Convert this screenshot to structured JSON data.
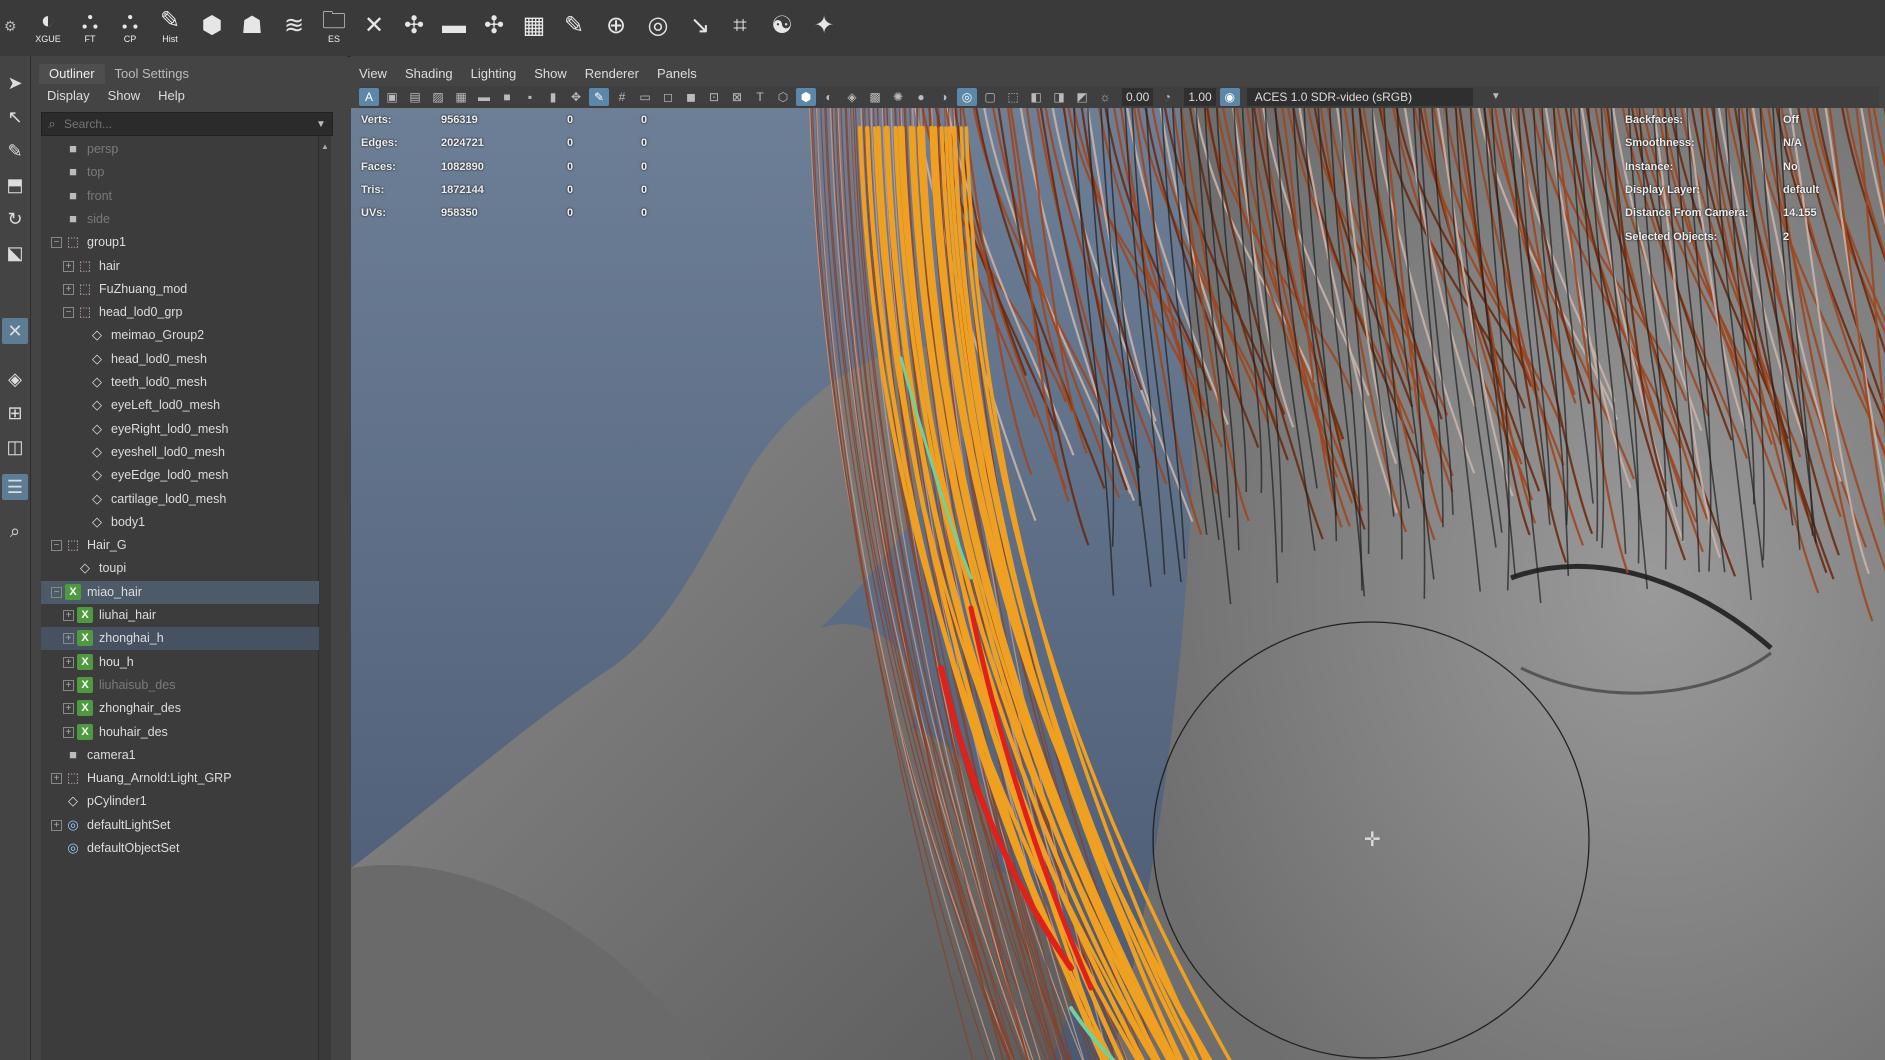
{
  "shelf": [
    {
      "icon": "xgen-logo-icon",
      "cap": "XGUE"
    },
    {
      "icon": "ft-icon",
      "cap": "FT"
    },
    {
      "icon": "cp-icon",
      "cap": "CP"
    },
    {
      "icon": "hist-icon",
      "cap": "Hist"
    },
    {
      "icon": "lattice-icon",
      "cap": ""
    },
    {
      "icon": "head-icon",
      "cap": ""
    },
    {
      "icon": "layers-icon",
      "cap": ""
    },
    {
      "icon": "folder-es-icon",
      "cap": "ES"
    },
    {
      "icon": "tool-icon",
      "cap": ""
    },
    {
      "icon": "transform-icon",
      "cap": ""
    },
    {
      "icon": "ruler-icon",
      "cap": ""
    },
    {
      "icon": "snap-icon",
      "cap": ""
    },
    {
      "icon": "grid-icon",
      "cap": ""
    },
    {
      "icon": "pen-icon",
      "cap": ""
    },
    {
      "icon": "sphere-grid-icon",
      "cap": ""
    },
    {
      "icon": "target-icon",
      "cap": ""
    },
    {
      "icon": "joint-icon",
      "cap": ""
    },
    {
      "icon": "bounds-icon",
      "cap": ""
    },
    {
      "icon": "yinyang-icon",
      "cap": ""
    },
    {
      "icon": "mask-icon",
      "cap": ""
    }
  ],
  "outliner": {
    "tabs": [
      "Outliner",
      "Tool Settings"
    ],
    "menu": [
      "Display",
      "Show",
      "Help"
    ],
    "search_placeholder": "Search...",
    "items": [
      {
        "label": "persp",
        "type": "cam",
        "depth": 1,
        "expand": "",
        "state": "dim"
      },
      {
        "label": "top",
        "type": "cam",
        "depth": 1,
        "expand": "",
        "state": "dim"
      },
      {
        "label": "front",
        "type": "cam",
        "depth": 1,
        "expand": "",
        "state": "dim"
      },
      {
        "label": "side",
        "type": "cam",
        "depth": 1,
        "expand": "",
        "state": "dim"
      },
      {
        "label": "group1",
        "type": "grp",
        "depth": 1,
        "expand": "−",
        "state": ""
      },
      {
        "label": "hair",
        "type": "grp",
        "depth": 2,
        "expand": "+",
        "state": ""
      },
      {
        "label": "FuZhuang_mod",
        "type": "grp",
        "depth": 2,
        "expand": "+",
        "state": ""
      },
      {
        "label": "head_lod0_grp",
        "type": "grp",
        "depth": 2,
        "expand": "−",
        "state": ""
      },
      {
        "label": "meimao_Group2",
        "type": "mesh",
        "depth": 3,
        "expand": "",
        "state": ""
      },
      {
        "label": "head_lod0_mesh",
        "type": "mesh",
        "depth": 3,
        "expand": "",
        "state": ""
      },
      {
        "label": "teeth_lod0_mesh",
        "type": "mesh",
        "depth": 3,
        "expand": "",
        "state": ""
      },
      {
        "label": "eyeLeft_lod0_mesh",
        "type": "mesh",
        "depth": 3,
        "expand": "",
        "state": ""
      },
      {
        "label": "eyeRight_lod0_mesh",
        "type": "mesh",
        "depth": 3,
        "expand": "",
        "state": ""
      },
      {
        "label": "eyeshell_lod0_mesh",
        "type": "mesh",
        "depth": 3,
        "expand": "",
        "state": ""
      },
      {
        "label": "eyeEdge_lod0_mesh",
        "type": "mesh",
        "depth": 3,
        "expand": "",
        "state": ""
      },
      {
        "label": "cartilage_lod0_mesh",
        "type": "mesh",
        "depth": 3,
        "expand": "",
        "state": ""
      },
      {
        "label": "body1",
        "type": "mesh",
        "depth": 3,
        "expand": "",
        "state": ""
      },
      {
        "label": "Hair_G",
        "type": "grp",
        "depth": 1,
        "expand": "−",
        "state": ""
      },
      {
        "label": "toupi",
        "type": "mesh",
        "depth": 2,
        "expand": "",
        "state": ""
      },
      {
        "label": "miao_hair",
        "type": "xg",
        "depth": 1,
        "expand": "−",
        "state": "sel"
      },
      {
        "label": "liuhai_hair",
        "type": "xg",
        "depth": 2,
        "expand": "+",
        "state": ""
      },
      {
        "label": "zhonghai_h",
        "type": "xg",
        "depth": 2,
        "expand": "+",
        "state": "sel2"
      },
      {
        "label": "hou_h",
        "type": "xg",
        "depth": 2,
        "expand": "+",
        "state": ""
      },
      {
        "label": "liuhaisub_des",
        "type": "xg",
        "depth": 2,
        "expand": "+",
        "state": "dim"
      },
      {
        "label": "zhonghair_des",
        "type": "xg",
        "depth": 2,
        "expand": "+",
        "state": ""
      },
      {
        "label": "houhair_des",
        "type": "xg",
        "depth": 2,
        "expand": "+",
        "state": ""
      },
      {
        "label": "camera1",
        "type": "cam",
        "depth": 1,
        "expand": "",
        "state": ""
      },
      {
        "label": "Huang_Arnold:Light_GRP",
        "type": "grp",
        "depth": 1,
        "expand": "+",
        "state": ""
      },
      {
        "label": "pCylinder1",
        "type": "mesh",
        "depth": 1,
        "expand": "",
        "state": ""
      },
      {
        "label": "defaultLightSet",
        "type": "set",
        "depth": 1,
        "expand": "+",
        "state": ""
      },
      {
        "label": "defaultObjectSet",
        "type": "set",
        "depth": 1,
        "expand": "",
        "state": ""
      }
    ]
  },
  "viewport": {
    "menu": [
      "View",
      "Shading",
      "Lighting",
      "Show",
      "Renderer",
      "Panels"
    ],
    "toolbar": {
      "near_value": "0.00",
      "far_value": "1.00",
      "color_space": "ACES 1.0 SDR-video (sRGB)"
    },
    "stats": [
      {
        "label": "Verts:",
        "v1": "956319",
        "v2": "0",
        "v3": "0"
      },
      {
        "label": "Edges:",
        "v1": "2024721",
        "v2": "0",
        "v3": "0"
      },
      {
        "label": "Faces:",
        "v1": "1082890",
        "v2": "0",
        "v3": "0"
      },
      {
        "label": "Tris:",
        "v1": "1872144",
        "v2": "0",
        "v3": "0"
      },
      {
        "label": "UVs:",
        "v1": "958350",
        "v2": "0",
        "v3": "0"
      }
    ],
    "info": [
      {
        "label": "Backfaces:",
        "value": "Off"
      },
      {
        "label": "Smoothness:",
        "value": "N/A"
      },
      {
        "label": "Instance:",
        "value": "No"
      },
      {
        "label": "Display Layer:",
        "value": "default"
      },
      {
        "label": "Distance From Camera:",
        "value": "14.155"
      },
      {
        "label": "Selected Objects:",
        "value": "2"
      }
    ]
  },
  "colors": {
    "selection": "#4d5a68",
    "hair_brown": "#9a4a22",
    "guide_orange": "#f0a020",
    "guide_red": "#e0201a",
    "guide_green": "#6fd0a0",
    "bg_top": "#6d7f96",
    "bg_bottom": "#4a5a72"
  }
}
